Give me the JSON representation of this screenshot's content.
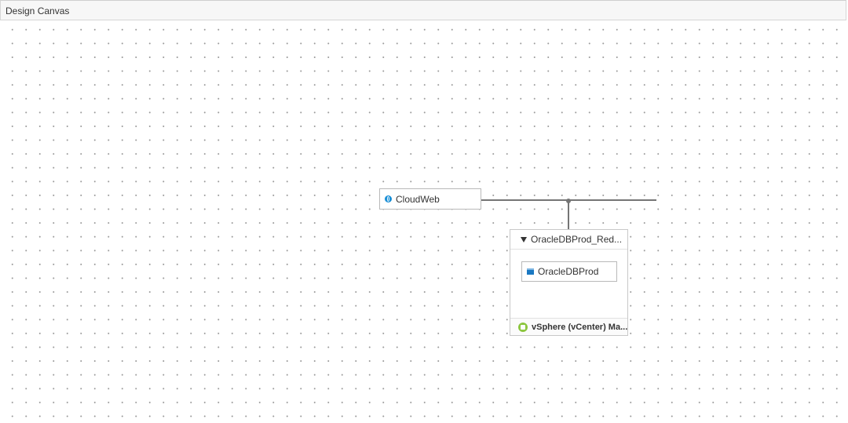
{
  "panel": {
    "title": "Design Canvas"
  },
  "canvas": {
    "nodes": {
      "cloudweb": {
        "label": "CloudWeb",
        "icon": "globe-icon"
      },
      "group": {
        "title": "OracleDBProd_Red...",
        "collapse_icon": "triangle-down-icon",
        "child": {
          "label": "OracleDBProd",
          "icon": "database-icon"
        },
        "footer": {
          "label": "vSphere (vCenter) Ma...",
          "icon": "vsphere-icon"
        }
      }
    }
  },
  "colors": {
    "connector": "#757575",
    "globe_icon": "#1a8fd6",
    "database_icon": "#1a78c2",
    "vsphere_icon": "#8cc63f"
  }
}
